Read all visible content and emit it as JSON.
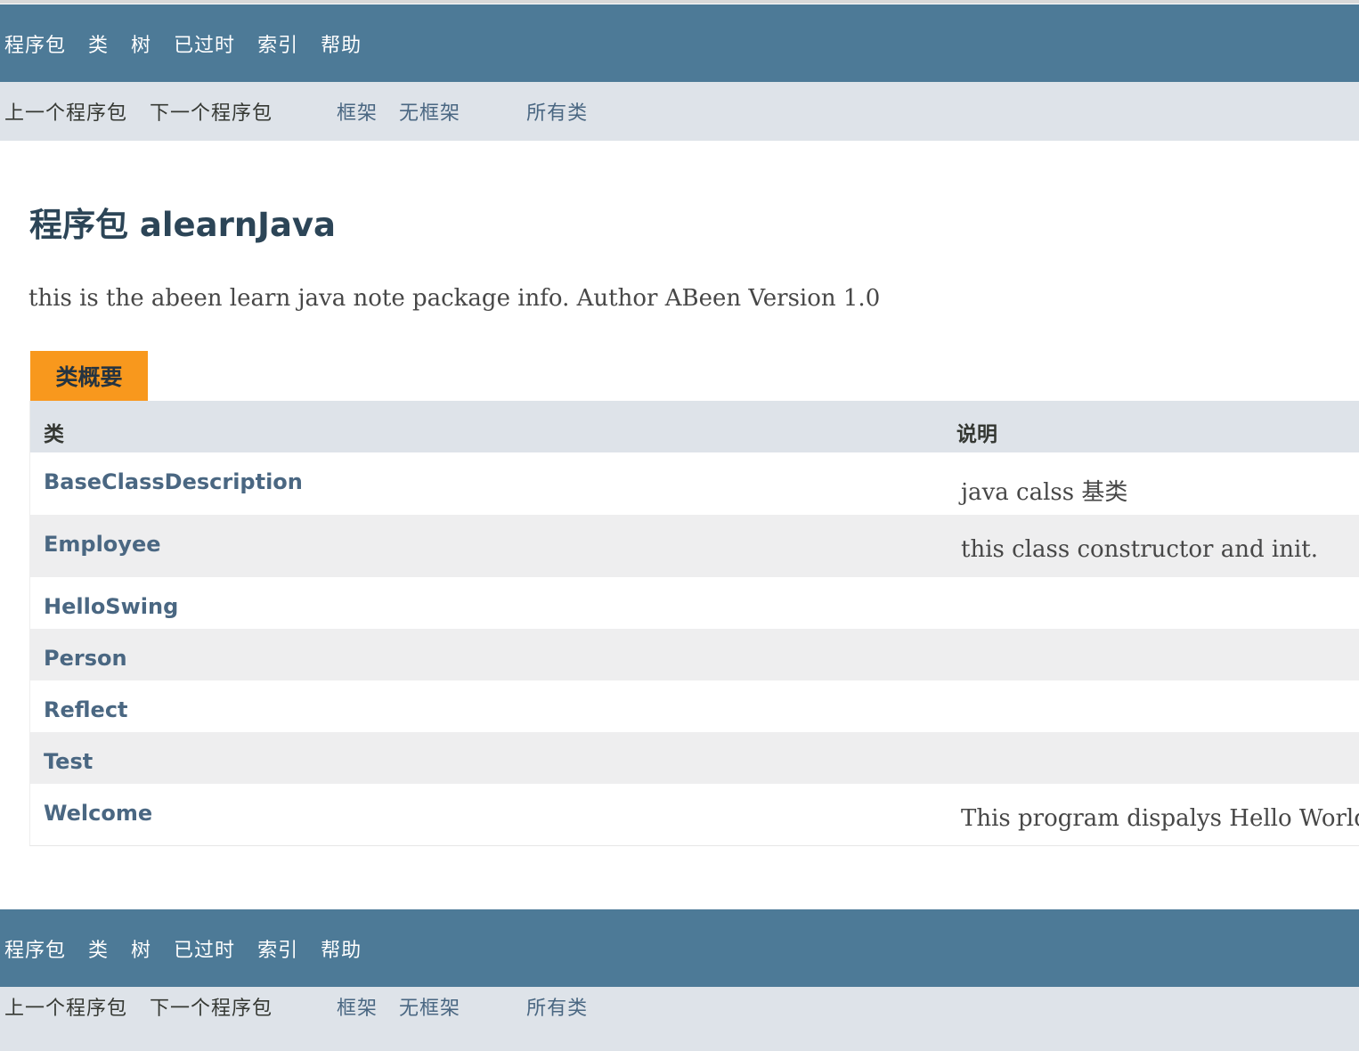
{
  "top_nav": {
    "items": [
      "程序包",
      "类",
      "树",
      "已过时",
      "索引",
      "帮助"
    ]
  },
  "sub_nav": {
    "prev_package": "上一个程序包",
    "next_package": "下一个程序包",
    "frames": "框架",
    "no_frames": "无框架",
    "all_classes": "所有类"
  },
  "page": {
    "title": "程序包 alearnJava",
    "description": "this is the abeen learn java note package info. Author ABeen Version 1.0"
  },
  "class_summary": {
    "caption": "类概要",
    "columns": [
      "类",
      "说明"
    ],
    "rows": [
      {
        "name": "BaseClassDescription",
        "description": "java calss 基类"
      },
      {
        "name": "Employee",
        "description": "this class constructor and init."
      },
      {
        "name": "HelloSwing",
        "description": ""
      },
      {
        "name": "Person",
        "description": ""
      },
      {
        "name": "Reflect",
        "description": ""
      },
      {
        "name": "Test",
        "description": ""
      },
      {
        "name": "Welcome",
        "description": "This program dispalys Hello World"
      }
    ]
  },
  "bottom_nav": {
    "items": [
      "程序包",
      "类",
      "树",
      "已过时",
      "索引",
      "帮助"
    ],
    "prev_package": "上一个程序包",
    "next_package": "下一个程序包",
    "frames": "框架",
    "no_frames": "无框架",
    "all_classes": "所有类"
  },
  "colors": {
    "nav_bg": "#4d7a97",
    "subnav_bg": "#dee3e9",
    "caption_bg": "#f8981d",
    "link": "#4a6782",
    "alt_row": "#eeeeef"
  }
}
